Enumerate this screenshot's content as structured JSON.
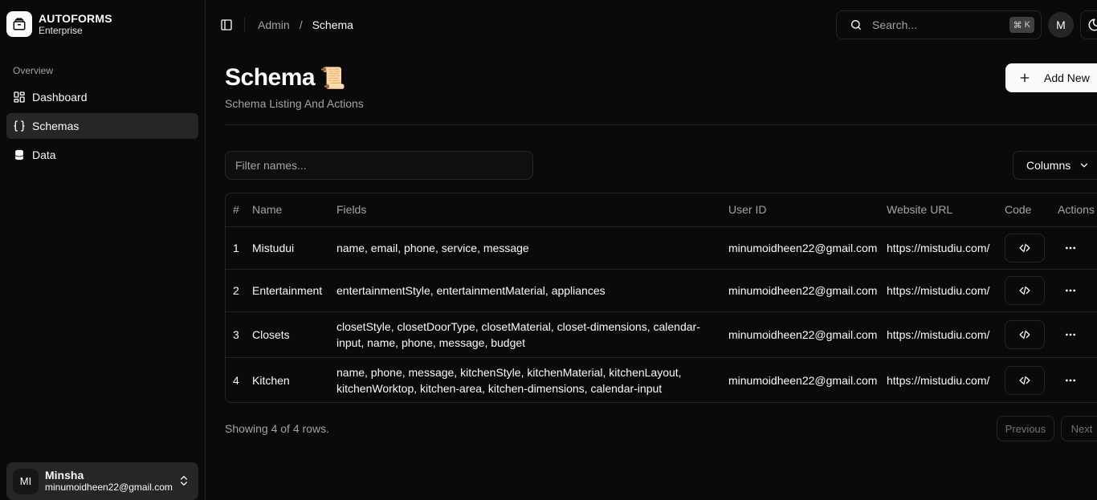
{
  "brand": {
    "name": "AUTOFORMS",
    "plan": "Enterprise"
  },
  "sidebar": {
    "group_label": "Overview",
    "items": [
      {
        "label": "Dashboard",
        "icon": "dashboard-icon"
      },
      {
        "label": "Schemas",
        "icon": "braces-icon",
        "active": true
      },
      {
        "label": "Data",
        "icon": "database-icon"
      }
    ]
  },
  "user": {
    "initials": "MI",
    "name": "Minsha",
    "email": "minumoidheen22@gmail.com"
  },
  "header": {
    "breadcrumb": [
      "Admin",
      "Schema"
    ],
    "search_placeholder": "Search...",
    "shortcut_symbol": "⌘",
    "shortcut_key": "K",
    "avatar_initial": "M"
  },
  "page": {
    "title": "Schema",
    "title_emoji": "📜",
    "subtitle": "Schema Listing And Actions",
    "add_button": "Add New"
  },
  "toolbar": {
    "filter_placeholder": "Filter names...",
    "columns_label": "Columns"
  },
  "table": {
    "headers": [
      "#",
      "Name",
      "Fields",
      "User ID",
      "Website URL",
      "Code",
      "Actions"
    ],
    "rows": [
      {
        "num": "1",
        "name": "Mistudui",
        "fields": "name, email, phone, service, message",
        "user_id": "minumoidheen22@gmail.com",
        "url": "https://mistudiu.com/"
      },
      {
        "num": "2",
        "name": "Entertainment",
        "fields": "entertainmentStyle, entertainmentMaterial, appliances",
        "user_id": "minumoidheen22@gmail.com",
        "url": "https://mistudiu.com/"
      },
      {
        "num": "3",
        "name": "Closets",
        "fields": "closetStyle, closetDoorType, closetMaterial, closet-dimensions, calendar-input, name, phone, message, budget",
        "user_id": "minumoidheen22@gmail.com",
        "url": "https://mistudiu.com/"
      },
      {
        "num": "4",
        "name": "Kitchen",
        "fields": "name, phone, message, kitchenStyle, kitchenMaterial, kitchenLayout, kitchenWorktop, kitchen-area, kitchen-dimensions, calendar-input",
        "user_id": "minumoidheen22@gmail.com",
        "url": "https://mistudiu.com/"
      }
    ]
  },
  "pagination": {
    "info": "Showing 4 of 4 rows.",
    "previous": "Previous",
    "next": "Next"
  }
}
